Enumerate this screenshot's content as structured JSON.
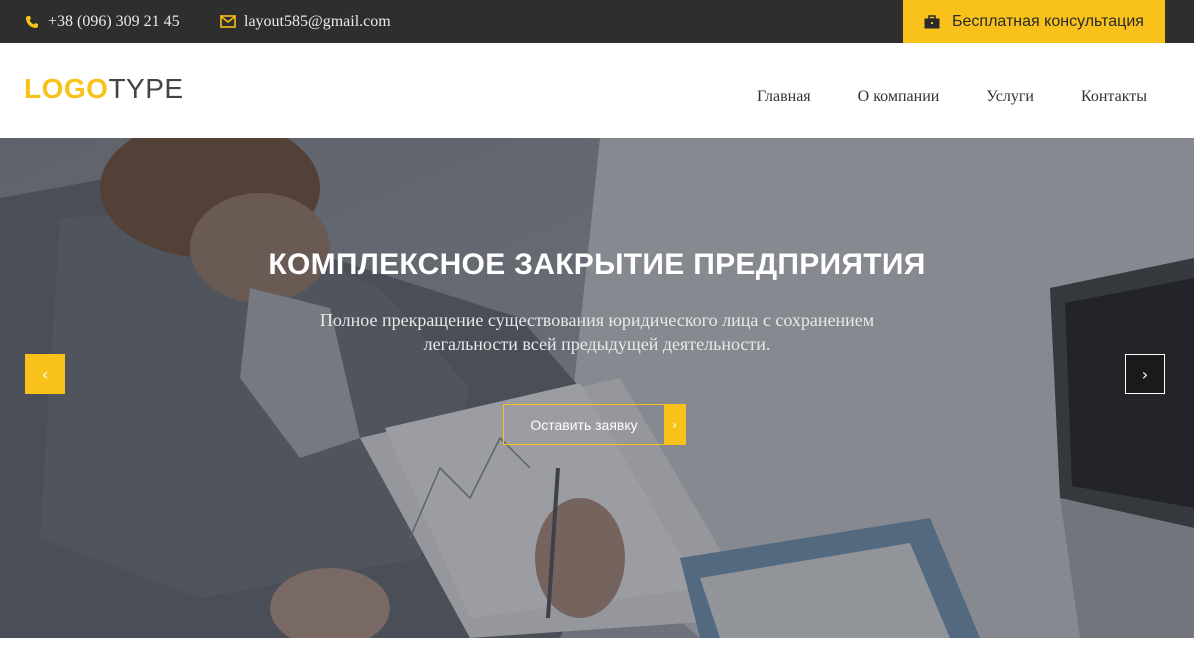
{
  "topbar": {
    "phone": "+38 (096) 309 21 45",
    "email": "layout585@gmail.com",
    "consult_label": "Бесплатная консультация",
    "icons": {
      "phone": "phone-icon",
      "email": "envelope-icon",
      "consult": "briefcase-icon"
    }
  },
  "header": {
    "logo_bold": "LOGO",
    "logo_light": "TYPE",
    "nav": [
      "Главная",
      "О компании",
      "Услуги",
      "Контакты"
    ]
  },
  "hero": {
    "title": "КОМПЛЕКСНОЕ ЗАКРЫТИЕ ПРЕДПРИЯТИЯ",
    "subtitle": "Полное прекращение существования юридического лица с сохранением легальности всей предыдущей деятельности.",
    "cta_label": "Оставить заявку",
    "prev_icon": "‹",
    "next_icon": "›",
    "cta_arrow": "›"
  },
  "colors": {
    "accent": "#f8c21b",
    "topbar_bg": "#2e2e2e",
    "text_dark": "#333333"
  }
}
